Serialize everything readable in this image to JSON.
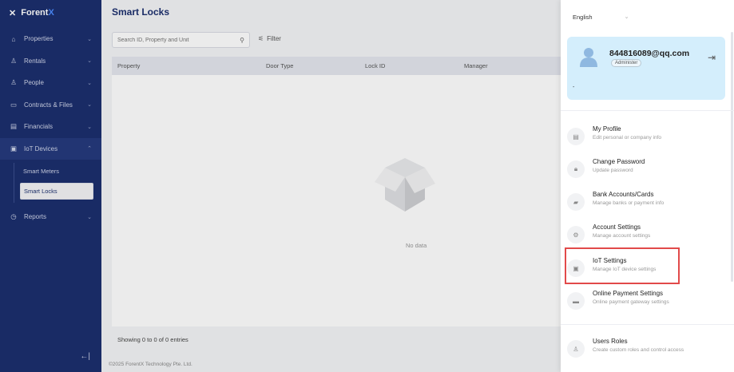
{
  "sidebar": {
    "brand_prefix": "Forent",
    "brand_suffix": "X",
    "items": [
      {
        "label": "Properties"
      },
      {
        "label": "Rentals"
      },
      {
        "label": "People"
      },
      {
        "label": "Contracts & Files"
      },
      {
        "label": "Financials"
      },
      {
        "label": "IoT Devices"
      },
      {
        "label": "Reports"
      }
    ],
    "sub_items": [
      {
        "label": "Smart Meters"
      },
      {
        "label": "Smart Locks"
      }
    ],
    "collapse_icon": "collapse-sidebar-icon"
  },
  "main": {
    "title": "Smart Locks",
    "search_placeholder": "Search ID, Property and Unit",
    "filter_label": "Filter",
    "columns": [
      "Property",
      "Door Type",
      "Lock ID",
      "Manager"
    ],
    "empty_text": "No data",
    "entries_text": "Showing 0 to 0 of 0 entries",
    "copyright": "2025 ForentX Technology Pte. Ltd."
  },
  "panel": {
    "language": "English",
    "user": {
      "email": "844816089@qq.com",
      "role": "Administer",
      "extra": "-"
    },
    "menu": [
      {
        "title": "My Profile",
        "subtitle": "Edit personal or company info",
        "icon": "profile-icon"
      },
      {
        "title": "Change Password",
        "subtitle": "Update password",
        "icon": "lock-icon"
      },
      {
        "title": "Bank Accounts/Cards",
        "subtitle": "Manage banks or payment info",
        "icon": "bank-icon"
      },
      {
        "title": "Account Settings",
        "subtitle": "Manage account settings",
        "icon": "gear-icon"
      },
      {
        "title": "IoT Settings",
        "subtitle": "Manage IoT device settings",
        "icon": "iot-icon"
      },
      {
        "title": "Online Payment Settings",
        "subtitle": "Online payment gateway settings",
        "icon": "card-icon"
      },
      {
        "title": "Users Roles",
        "subtitle": "Create custom roles and control access",
        "icon": "users-icon"
      }
    ]
  },
  "colors": {
    "sidebar_bg": "#1c2f6e",
    "accent": "#4d8cff",
    "highlight": "#e24a4a",
    "user_card_bg": "#d4eefc"
  }
}
